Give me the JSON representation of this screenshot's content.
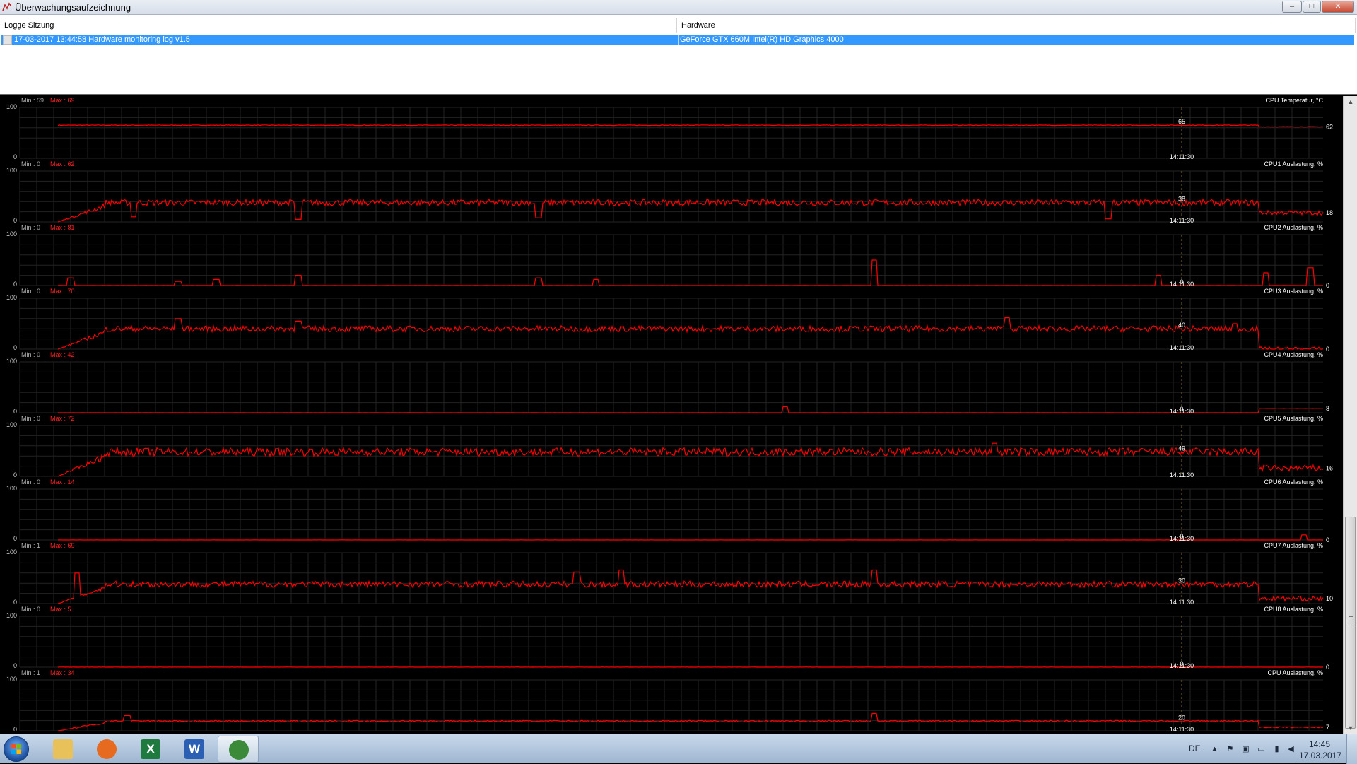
{
  "window": {
    "title": "Überwachungsaufzeichnung",
    "controls": {
      "minimize": "–",
      "maximize": "□",
      "close": "✕"
    }
  },
  "list": {
    "columns": [
      "Logge Sitzung",
      "Hardware"
    ],
    "rows": [
      {
        "session": "17-03-2017 13:44:58 Hardware monitoring log v1.5",
        "hardware": "GeForce GTX 660M,Intel(R) HD Graphics 4000",
        "selected": true
      }
    ]
  },
  "graph_style": {
    "line_color": "#ff0000",
    "grid_color": "#232323",
    "cursor_color": "#7a6a2a",
    "background": "#000000",
    "min_label_color": "#b0b0b0",
    "max_label_color": "#ff2020"
  },
  "chart_data": {
    "type": "line",
    "y_range": [
      0,
      100
    ],
    "y_tick_labels": [
      "100",
      "0"
    ],
    "cursor_time": "14:11:30",
    "graphs": [
      {
        "name": "CPU Temperatur, °C",
        "min_label": "Min : 59",
        "max_label": "Max : 69",
        "cursor_value": "65",
        "current_value": "62",
        "base": 65,
        "noise": 0.6,
        "spikes": [],
        "start_ramp": false,
        "end_level": 62
      },
      {
        "name": "CPU1 Auslastung, %",
        "min_label": "Min : 0",
        "max_label": "Max : 62",
        "cursor_value": "38",
        "current_value": "18",
        "base": 38,
        "noise": 6,
        "spikes": [
          [
            0.06,
            10
          ],
          [
            0.19,
            5
          ],
          [
            0.38,
            8
          ],
          [
            0.83,
            6
          ]
        ],
        "start_ramp": true,
        "end_level": 18
      },
      {
        "name": "CPU2 Auslastung, %",
        "min_label": "Min : 0",
        "max_label": "Max : 81",
        "cursor_value": "0",
        "current_value": "0",
        "base": 0,
        "noise": 0.3,
        "spikes": [
          [
            0.01,
            15
          ],
          [
            0.095,
            8
          ],
          [
            0.125,
            12
          ],
          [
            0.19,
            20
          ],
          [
            0.38,
            15
          ],
          [
            0.425,
            12
          ],
          [
            0.645,
            50
          ],
          [
            0.87,
            20
          ],
          [
            0.955,
            25
          ],
          [
            0.99,
            35
          ]
        ],
        "start_ramp": false,
        "end_level": 0
      },
      {
        "name": "CPU3 Auslastung, %",
        "min_label": "Min : 0",
        "max_label": "Max : 70",
        "cursor_value": "40",
        "current_value": "0",
        "base": 40,
        "noise": 6,
        "spikes": [
          [
            0.095,
            60
          ],
          [
            0.19,
            55
          ],
          [
            0.75,
            62
          ],
          [
            0.93,
            50
          ]
        ],
        "start_ramp": true,
        "end_level": 0
      },
      {
        "name": "CPU4 Auslastung, %",
        "min_label": "Min : 0",
        "max_label": "Max : 42",
        "cursor_value": "0",
        "current_value": "8",
        "base": 0,
        "noise": 0.3,
        "spikes": [
          [
            0.575,
            12
          ]
        ],
        "start_ramp": false,
        "end_level": 8
      },
      {
        "name": "CPU5 Auslastung, %",
        "min_label": "Min : 0",
        "max_label": "Max : 72",
        "cursor_value": "49",
        "current_value": "16",
        "base": 48,
        "noise": 8,
        "spikes": [
          [
            0.74,
            65
          ]
        ],
        "start_ramp": true,
        "end_level": 16
      },
      {
        "name": "CPU6 Auslastung, %",
        "min_label": "Min : 0",
        "max_label": "Max : 14",
        "cursor_value": "0",
        "current_value": "0",
        "base": 0,
        "noise": 0.2,
        "spikes": [
          [
            0.985,
            10
          ]
        ],
        "start_ramp": false,
        "end_level": 0
      },
      {
        "name": "CPU7 Auslastung, %",
        "min_label": "Min : 1",
        "max_label": "Max : 69",
        "cursor_value": "30",
        "current_value": "10",
        "base": 38,
        "noise": 6,
        "spikes": [
          [
            0.015,
            60
          ],
          [
            0.41,
            62
          ],
          [
            0.445,
            66
          ],
          [
            0.645,
            66
          ]
        ],
        "start_ramp": true,
        "end_level": 10
      },
      {
        "name": "CPU8 Auslastung, %",
        "min_label": "Min : 0",
        "max_label": "Max : 5",
        "cursor_value": "0",
        "current_value": "0",
        "base": 0,
        "noise": 0.4,
        "spikes": [],
        "start_ramp": false,
        "end_level": 0
      },
      {
        "name": "CPU Auslastung, %",
        "min_label": "Min : 1",
        "max_label": "Max : 34",
        "cursor_value": "20",
        "current_value": "7",
        "base": 19,
        "noise": 1.5,
        "spikes": [
          [
            0.055,
            30
          ],
          [
            0.645,
            34
          ]
        ],
        "start_ramp": true,
        "end_level": 7
      }
    ]
  },
  "taskbar": {
    "apps": [
      {
        "name": "explorer",
        "icon": "folder-icon",
        "color": "#e8c15a"
      },
      {
        "name": "firefox",
        "icon": "firefox-icon",
        "color": "#e66a1f"
      },
      {
        "name": "excel",
        "icon": "excel-icon",
        "color": "#1f7a3f",
        "letter": "X"
      },
      {
        "name": "word",
        "icon": "word-icon",
        "color": "#2b5fb3",
        "letter": "W"
      },
      {
        "name": "msi-afterburner",
        "icon": "afterburner-icon",
        "color": "#3a8a3a",
        "active": true
      }
    ],
    "language": "DE",
    "time": "14:45",
    "date": "17.03.2017"
  }
}
